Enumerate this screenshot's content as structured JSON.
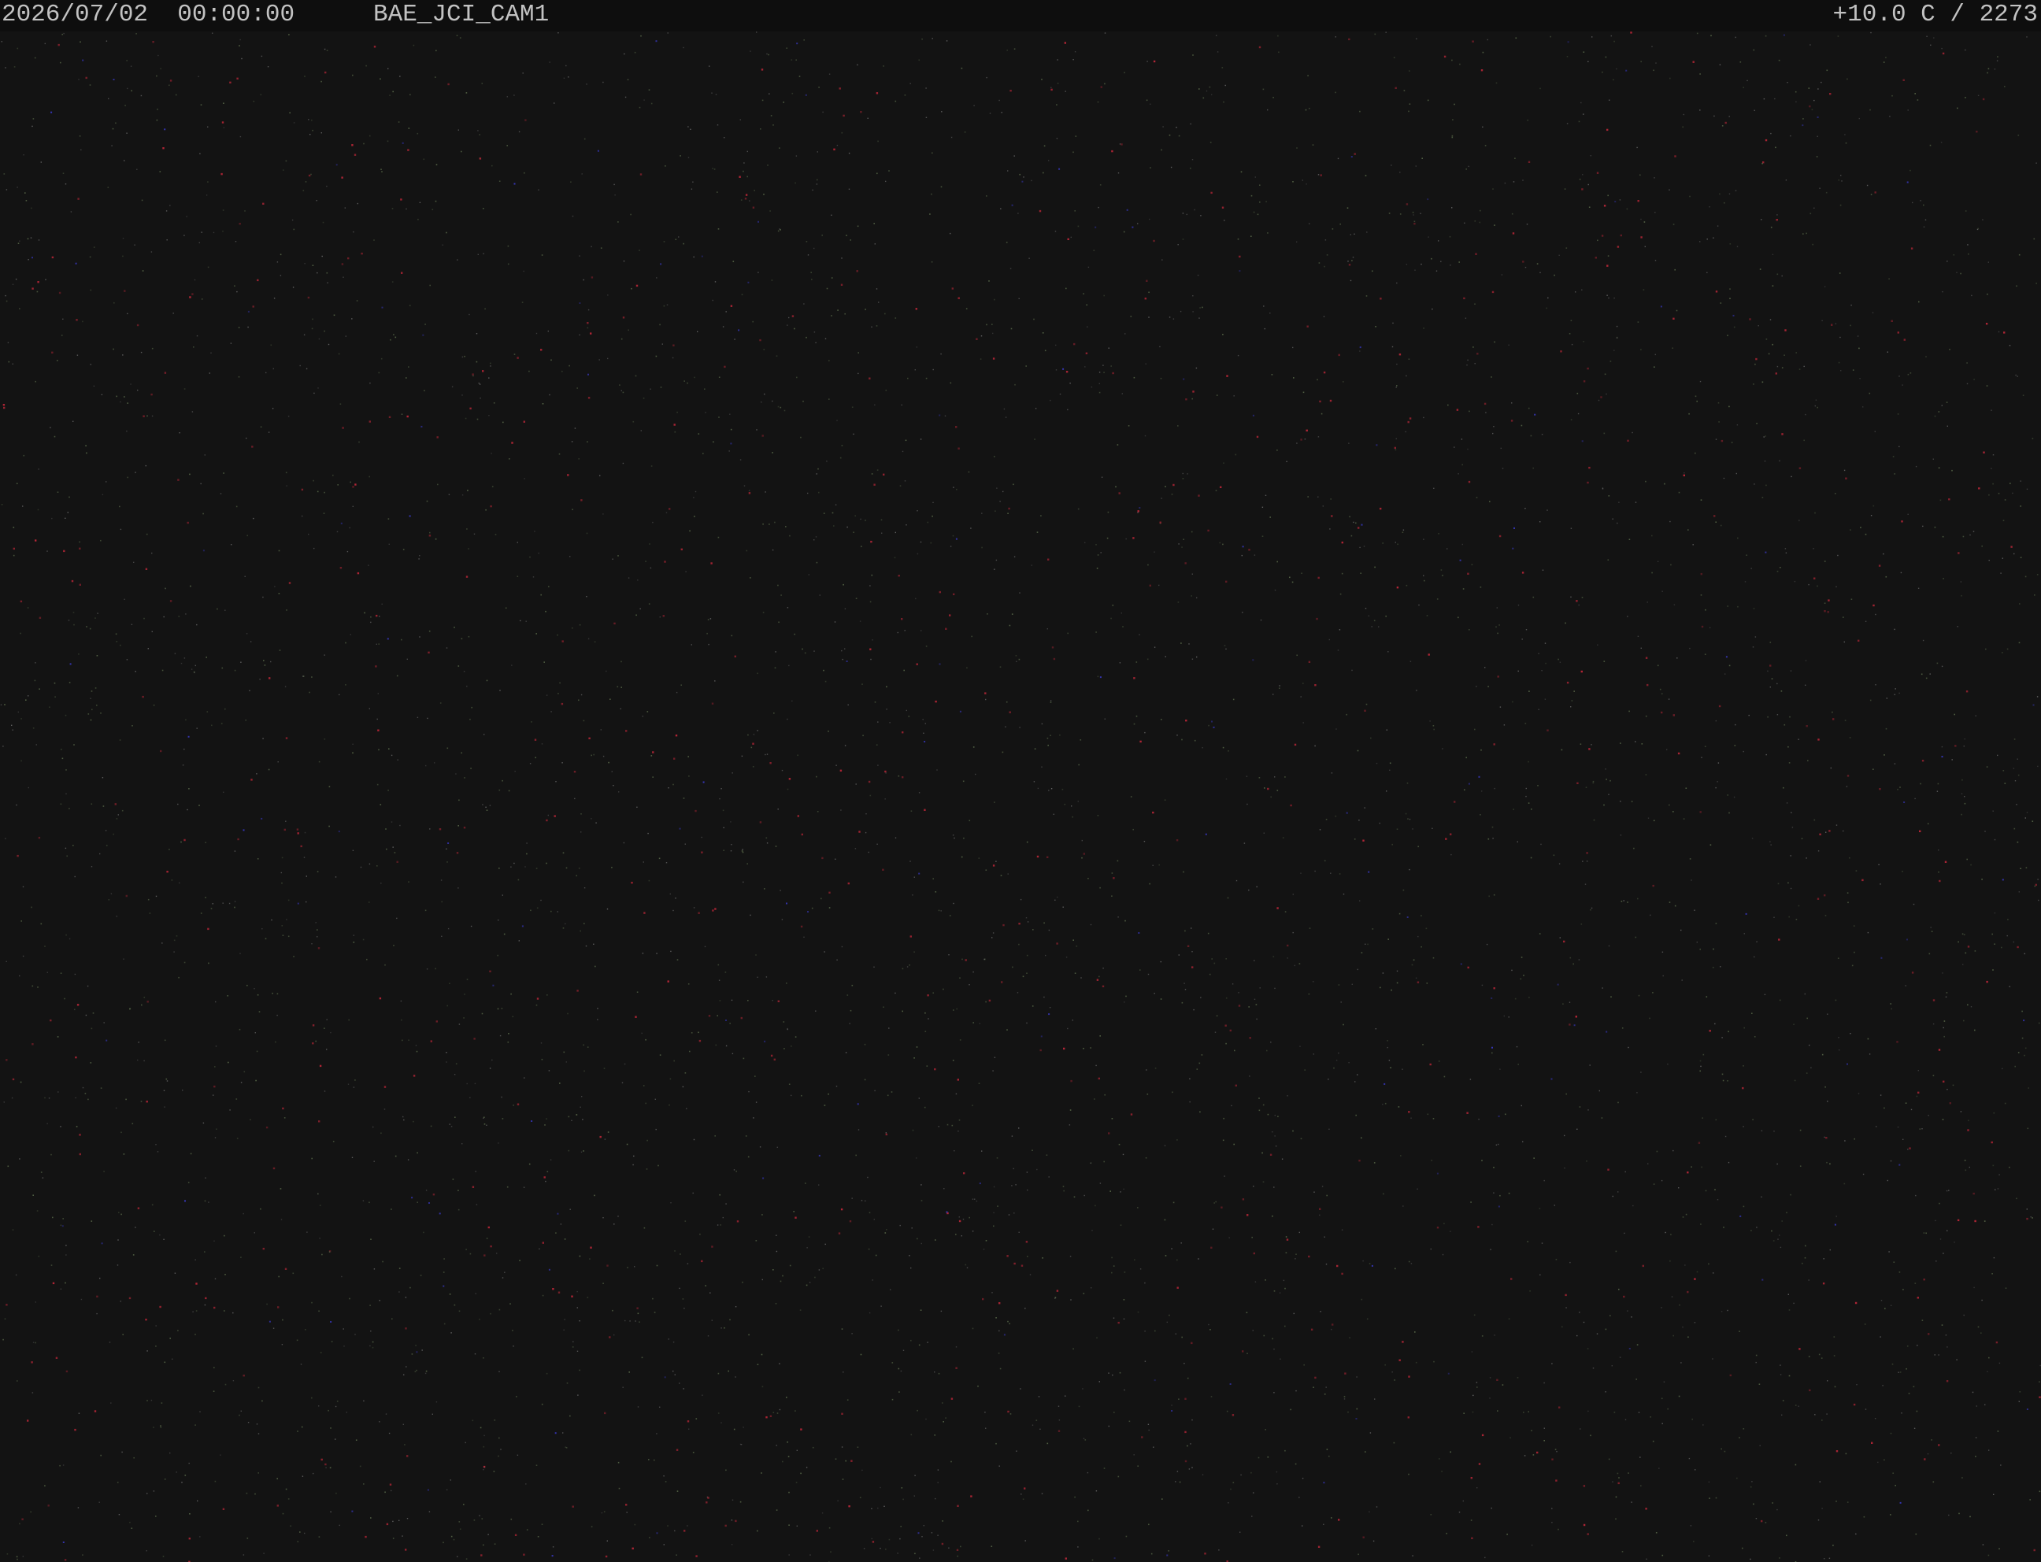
{
  "overlay": {
    "timestamp": "2026/07/02  00:00:00",
    "camera_id": "BAE_JCI_CAM1",
    "temperature_reading": "+10.0 C / 2273"
  },
  "colors": {
    "background": "#131313",
    "overlay_bar": "#0e0e0e",
    "overlay_text": "#c2c2c2",
    "noise_red": "#c4283a",
    "noise_green": "#5a6a4a",
    "noise_blue": "#3a3ac8"
  }
}
